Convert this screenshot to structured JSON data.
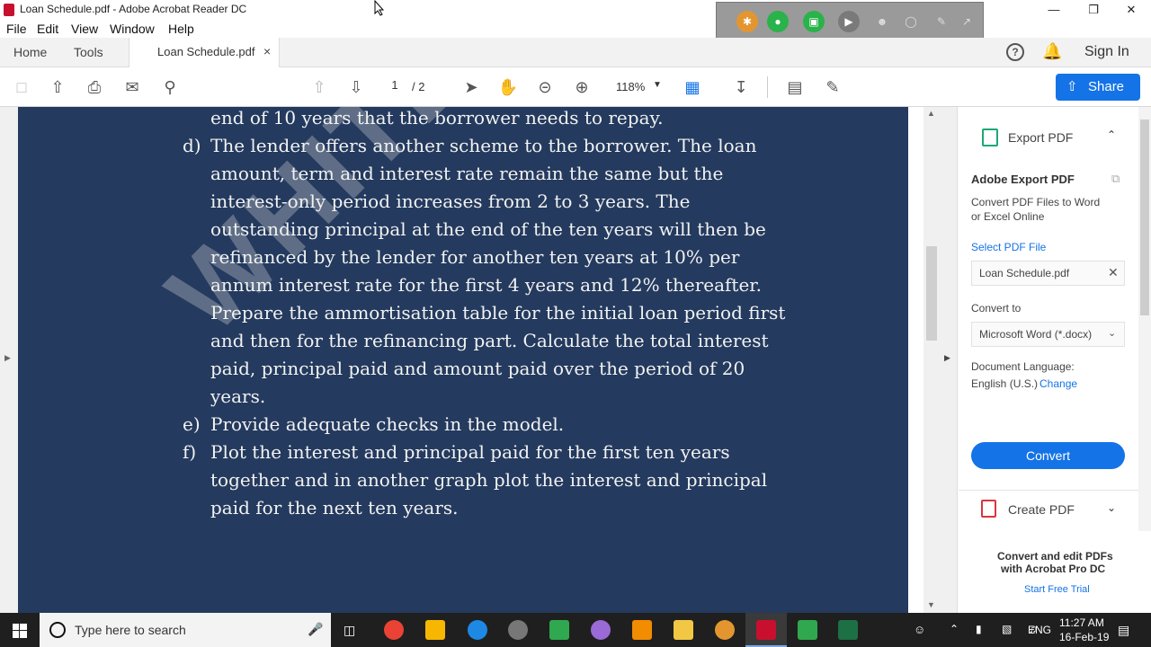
{
  "window": {
    "title": "Loan Schedule.pdf - Adobe Acrobat Reader DC"
  },
  "menu": [
    "File",
    "Edit",
    "View",
    "Window",
    "Help"
  ],
  "tabs": {
    "home": "Home",
    "tools": "Tools",
    "document": "Loan Schedule.pdf",
    "close": "×"
  },
  "header": {
    "sign_in": "Sign In"
  },
  "toolbar": {
    "page_current": "1",
    "page_total": "/ 2",
    "zoom": "118%",
    "share_label": "Share"
  },
  "document": {
    "watermark": "WHITEKNIGHT",
    "lines": [
      {
        "marker": "",
        "text": "end of 10 years that the borrower needs to repay."
      },
      {
        "marker": "d)",
        "text": "The lender offers another scheme to the borrower. The loan"
      },
      {
        "marker": "",
        "text": "amount, term and interest rate remain the same but the"
      },
      {
        "marker": "",
        "text": "interest-only period increases from 2 to 3 years. The"
      },
      {
        "marker": "",
        "text": "outstanding principal at the end of the ten years will then be"
      },
      {
        "marker": "",
        "text": "refinanced by the lender for another ten years at 10% per"
      },
      {
        "marker": "",
        "text": "annum interest rate for the first 4 years and 12% thereafter."
      },
      {
        "marker": "",
        "text": "Prepare the ammortisation table for the initial loan period first"
      },
      {
        "marker": "",
        "text": "and then for the refinancing part. Calculate the total interest"
      },
      {
        "marker": "",
        "text": "paid, principal paid and amount paid over the period of 20"
      },
      {
        "marker": "",
        "text": "years."
      },
      {
        "marker": "e)",
        "text": "Provide adequate checks in the model."
      },
      {
        "marker": "f)",
        "text": "Plot the interest and principal paid for the first ten years"
      },
      {
        "marker": "",
        "text": "together and in another graph plot the interest and principal"
      },
      {
        "marker": "",
        "text": "paid for the next ten years."
      }
    ]
  },
  "right_pane": {
    "export_header": "Export PDF",
    "title": "Adobe Export PDF",
    "description_1": "Convert PDF Files to Word",
    "description_2": "or Excel Online",
    "select_file_label": "Select PDF File",
    "selected_file": "Loan Schedule.pdf",
    "convert_to_label": "Convert to",
    "convert_to_value": "Microsoft Word (*.docx)",
    "doc_language_label": "Document Language:",
    "doc_language_value": "English (U.S.)",
    "change_link": "Change",
    "convert_button": "Convert",
    "create_pdf": "Create PDF",
    "promo_1": "Convert and edit PDFs",
    "promo_2": "with Acrobat Pro DC",
    "trial_link": "Start Free Trial"
  },
  "taskbar": {
    "search_placeholder": "Type here to search",
    "language": "ENG",
    "time": "11:27 AM",
    "date": "16-Feb-19"
  }
}
